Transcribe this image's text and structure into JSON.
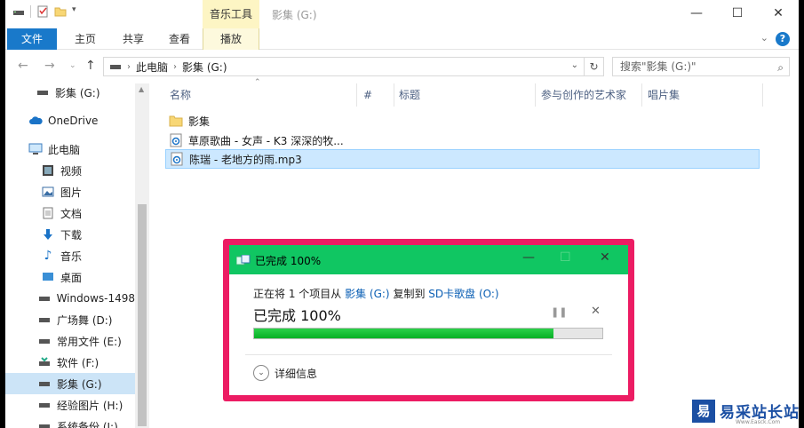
{
  "window": {
    "title": "影集 (G:)",
    "context_tab_header": "音乐工具"
  },
  "ribbon": {
    "tabs": [
      "文件",
      "主页",
      "共享",
      "查看",
      "播放"
    ]
  },
  "address": {
    "crumbs": [
      "此电脑",
      "影集 (G:)"
    ],
    "search_placeholder": "搜索\"影集 (G:)\""
  },
  "navpane": {
    "items": [
      {
        "label": "影集 (G:)",
        "icon": "drive-icon"
      },
      {
        "label": "OneDrive",
        "icon": "cloud-icon"
      },
      {
        "label": "此电脑",
        "icon": "computer-icon"
      },
      {
        "label": "视频",
        "icon": "video-folder-icon"
      },
      {
        "label": "图片",
        "icon": "pictures-folder-icon"
      },
      {
        "label": "文档",
        "icon": "documents-folder-icon"
      },
      {
        "label": "下载",
        "icon": "download-icon"
      },
      {
        "label": "音乐",
        "icon": "music-icon"
      },
      {
        "label": "桌面",
        "icon": "desktop-icon"
      },
      {
        "label": "Windows-1498",
        "icon": "drive-icon"
      },
      {
        "label": "广场舞 (D:)",
        "icon": "drive-icon"
      },
      {
        "label": "常用文件 (E:)",
        "icon": "drive-icon"
      },
      {
        "label": "软件  (F:)",
        "icon": "drive-icon"
      },
      {
        "label": "影集 (G:)",
        "icon": "drive-icon"
      },
      {
        "label": "经验图片 (H:)",
        "icon": "drive-icon"
      },
      {
        "label": "系统备份 (I:)",
        "icon": "drive-icon"
      }
    ]
  },
  "columns": [
    "名称",
    "#",
    "标题",
    "参与创作的艺术家",
    "唱片集"
  ],
  "files": [
    {
      "name": "影集",
      "icon": "folder-icon"
    },
    {
      "name": "草原歌曲 - 女声 - K3 深深的牧...",
      "icon": "audio-file-icon"
    },
    {
      "name": "陈瑞 - 老地方的雨.mp3",
      "icon": "audio-file-icon"
    }
  ],
  "dialog": {
    "title": "已完成 100%",
    "line_prefix": "正在将 1 个项目从",
    "source": "影集 (G:)",
    "line_mid": "复制到",
    "destination": "SD卡歌盘 (O:)",
    "status": "已完成 100%",
    "progress": 0.86,
    "details_label": "详细信息"
  },
  "watermark": {
    "text": "易采站长站",
    "sub": "Www.Easck.Com"
  },
  "colors": {
    "accent": "#1979ca",
    "dialog_titlebar": "#10c662",
    "progress_fill": "#06b025",
    "highlight_border": "#ec1c63",
    "selection": "#cce8ff"
  }
}
